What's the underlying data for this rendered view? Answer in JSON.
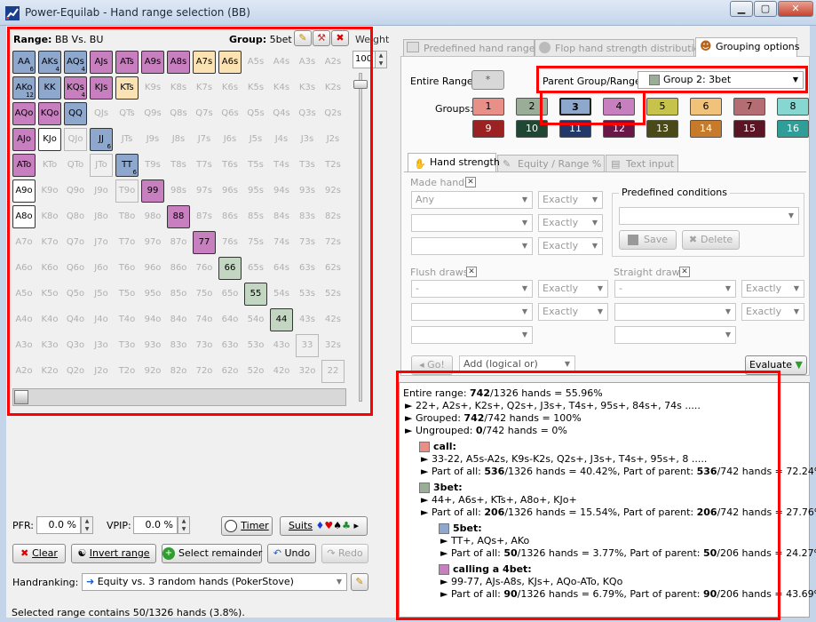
{
  "window": {
    "title": "Power-Equilab - Hand range selection (BB)"
  },
  "range": {
    "label_prefix": "Range:",
    "label_value": "BB Vs. BU",
    "group_prefix": "Group:",
    "group_value": "5bet",
    "weight_label": "Weight",
    "weight_value": "100"
  },
  "grid": {
    "rows": [
      [
        "AA",
        "AKs",
        "AQs",
        "AJs",
        "ATs",
        "A9s",
        "A8s",
        "A7s",
        "A6s",
        "A5s",
        "A4s",
        "A3s",
        "A2s"
      ],
      [
        "AKo",
        "KK",
        "KQs",
        "KJs",
        "KTs",
        "K9s",
        "K8s",
        "K7s",
        "K6s",
        "K5s",
        "K4s",
        "K3s",
        "K2s"
      ],
      [
        "AQo",
        "KQo",
        "QQ",
        "QJs",
        "QTs",
        "Q9s",
        "Q8s",
        "Q7s",
        "Q6s",
        "Q5s",
        "Q4s",
        "Q3s",
        "Q2s"
      ],
      [
        "AJo",
        "KJo",
        "QJo",
        "JJ",
        "JTs",
        "J9s",
        "J8s",
        "J7s",
        "J6s",
        "J5s",
        "J4s",
        "J3s",
        "J2s"
      ],
      [
        "ATo",
        "KTo",
        "QTo",
        "JTo",
        "TT",
        "T9s",
        "T8s",
        "T7s",
        "T6s",
        "T5s",
        "T4s",
        "T3s",
        "T2s"
      ],
      [
        "A9o",
        "K9o",
        "Q9o",
        "J9o",
        "T9o",
        "99",
        "98s",
        "97s",
        "96s",
        "95s",
        "94s",
        "93s",
        "92s"
      ],
      [
        "A8o",
        "K8o",
        "Q8o",
        "J8o",
        "T8o",
        "98o",
        "88",
        "87s",
        "86s",
        "85s",
        "84s",
        "83s",
        "82s"
      ],
      [
        "A7o",
        "K7o",
        "Q7o",
        "J7o",
        "T7o",
        "97o",
        "87o",
        "77",
        "76s",
        "75s",
        "74s",
        "73s",
        "72s"
      ],
      [
        "A6o",
        "K6o",
        "Q6o",
        "J6o",
        "T6o",
        "96o",
        "86o",
        "76o",
        "66",
        "65s",
        "64s",
        "63s",
        "62s"
      ],
      [
        "A5o",
        "K5o",
        "Q5o",
        "J5o",
        "T5o",
        "95o",
        "85o",
        "75o",
        "65o",
        "55",
        "54s",
        "53s",
        "52s"
      ],
      [
        "A4o",
        "K4o",
        "Q4o",
        "J4o",
        "T4o",
        "94o",
        "84o",
        "74o",
        "64o",
        "54o",
        "44",
        "43s",
        "42s"
      ],
      [
        "A3o",
        "K3o",
        "Q3o",
        "J3o",
        "T3o",
        "93o",
        "83o",
        "73o",
        "63o",
        "53o",
        "43o",
        "33",
        "32s"
      ],
      [
        "A2o",
        "K2o",
        "Q2o",
        "J2o",
        "T2o",
        "92o",
        "82o",
        "72o",
        "62o",
        "52o",
        "42o",
        "32o",
        "22"
      ]
    ],
    "counts": {
      "AA": "6",
      "AKs": "4",
      "AQs": "4",
      "AKo": "12",
      "KQs": "4",
      "JJ": "6",
      "TT": "6"
    },
    "colors": {
      "blue": "#8ea7cc",
      "purple": "#c77fbf",
      "peach": "#fbe2b3",
      "sage": "#c3d6c2",
      "white": "#ffffff"
    }
  },
  "stats": {
    "pfr_label": "PFR:",
    "pfr_value": "0.0 %",
    "vpip_label": "VPIP:",
    "vpip_value": "0.0 %",
    "timer_label": "Timer",
    "suits_label": "Suits",
    "suits_glyphs": [
      "♦",
      "♥",
      "♠",
      "♣"
    ]
  },
  "actions": {
    "clear": "Clear",
    "invert": "Invert range",
    "select_remainder": "Select remainder",
    "undo": "Undo",
    "redo": "Redo"
  },
  "handranking": {
    "label": "Handranking:",
    "value": "Equity vs. 3 random hands (PokerStove)"
  },
  "status": {
    "text": "Selected range contains 50/1326 hands (3.8%)."
  },
  "tabs": {
    "predefined": "Predefined hand ranges",
    "flop": "Flop hand strength distribution",
    "grouping": "Grouping options"
  },
  "grouping": {
    "entire_range_label": "Entire Range:",
    "entire_range_btn": "*",
    "parent_label": "Parent Group/Range:",
    "parent_value": "Group 2: 3bet",
    "groups_label": "Groups:",
    "groups": [
      {
        "n": "1",
        "c": "#e88f87"
      },
      {
        "n": "2",
        "c": "#99ad97"
      },
      {
        "n": "3",
        "c": "#8ea7cc"
      },
      {
        "n": "4",
        "c": "#c77fbf"
      },
      {
        "n": "5",
        "c": "#c6c24a"
      },
      {
        "n": "6",
        "c": "#f0c27a"
      },
      {
        "n": "7",
        "c": "#b36d73"
      },
      {
        "n": "8",
        "c": "#86d6d2"
      },
      {
        "n": "9",
        "c": "#9c2121"
      },
      {
        "n": "10",
        "c": "#1f4733"
      },
      {
        "n": "11",
        "c": "#22386a"
      },
      {
        "n": "12",
        "c": "#6a1747"
      },
      {
        "n": "13",
        "c": "#4a4a18"
      },
      {
        "n": "14",
        "c": "#c77a2a"
      },
      {
        "n": "15",
        "c": "#5b1424"
      },
      {
        "n": "16",
        "c": "#2f9d98"
      }
    ],
    "subtabs": {
      "hand_strength": "Hand strength",
      "equity": "Equity / Range %",
      "text_input": "Text input"
    },
    "made_hands": "Made hands",
    "made_any": "Any",
    "exactly": "Exactly",
    "predefined_conditions": "Predefined conditions",
    "save": "Save",
    "delete": "Delete",
    "flush_draws": "Flush draws",
    "straight_draws": "Straight draws",
    "dash": "-",
    "go": "Go!",
    "add_logical": "Add (logical or)",
    "evaluate": "Evaluate"
  },
  "results": {
    "entire_prefix": "Entire range: ",
    "entire_bold": "742",
    "entire_suffix": "/1326 hands = 55.96%",
    "entire_line2": "22+, A2s+, K2s+, Q2s+, J3s+, T4s+, 95s+, 84s+, 74s .....",
    "grouped_prefix": "Grouped: ",
    "grouped_bold": "742",
    "grouped_suffix": "/742 hands = 100%",
    "ungrouped_prefix": "Ungrouped: ",
    "ungrouped_bold": "0",
    "ungrouped_suffix": "/742 hands = 0%",
    "groups": [
      {
        "name": "call:",
        "range": "33-22, A5s-A2s, K9s-K2s, Q2s+, J3s+, T4s+, 95s+, 8 .....",
        "p1": "Part of all: ",
        "b1": "536",
        "p2": "/1326 hands = 40.42%, Part of parent: ",
        "b2": "536",
        "p3": "/742 hands = 72.24%",
        "color": "#e88f87"
      },
      {
        "name": "3bet:",
        "range": "44+, A6s+, KTs+, A8o+, KJo+",
        "p1": "Part of all: ",
        "b1": "206",
        "p2": "/1326 hands = 15.54%, Part of parent: ",
        "b2": "206",
        "p3": "/742 hands = 27.76%",
        "color": "#99ad97"
      },
      {
        "name": "5bet:",
        "range": "TT+, AQs+, AKo",
        "p1": "Part of all: ",
        "b1": "50",
        "p2": "/1326 hands = 3.77%, Part of parent: ",
        "b2": "50",
        "p3": "/206 hands = 24.27%",
        "color": "#8ea7cc"
      },
      {
        "name": "calling a 4bet:",
        "range": "99-77, AJs-A8s, KJs+, AQo-ATo, KQo",
        "p1": "Part of all: ",
        "b1": "90",
        "p2": "/1326 hands = 6.79%, Part of parent: ",
        "b2": "90",
        "p3": "/206 hands = 43.69%",
        "color": "#c77fbf"
      }
    ]
  }
}
